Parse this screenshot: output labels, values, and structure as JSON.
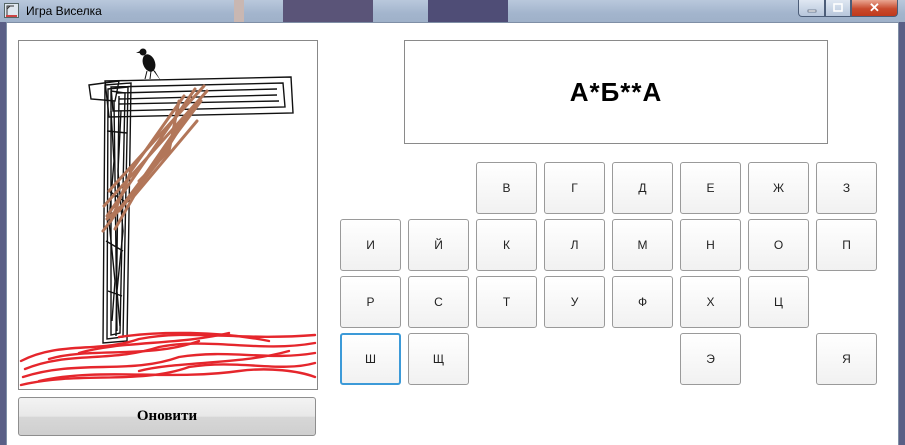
{
  "window": {
    "title": "Игра Виселка",
    "controls": {
      "minimize": "",
      "maximize": "",
      "close": "✕"
    }
  },
  "word_display": "А*Б**А",
  "refresh_label": "Оновити",
  "keyboard": {
    "rows": [
      [
        "",
        "",
        "В",
        "Г",
        "Д",
        "Е",
        "Ж",
        "З"
      ],
      [
        "И",
        "Й",
        "К",
        "Л",
        "М",
        "Н",
        "О",
        "П"
      ],
      [
        "Р",
        "С",
        "Т",
        "У",
        "Ф",
        "Х",
        "Ц",
        ""
      ],
      [
        "Ш",
        "Щ",
        "",
        "",
        "",
        "Э",
        "",
        "Я"
      ]
    ],
    "focused": "Ш"
  },
  "colors": {
    "ground": "#e5262c",
    "rope": "#b27659",
    "gallows": "#111111",
    "focus": "#3c9ad8"
  },
  "icons": {
    "app": "app-icon",
    "crow": "crow-icon"
  }
}
